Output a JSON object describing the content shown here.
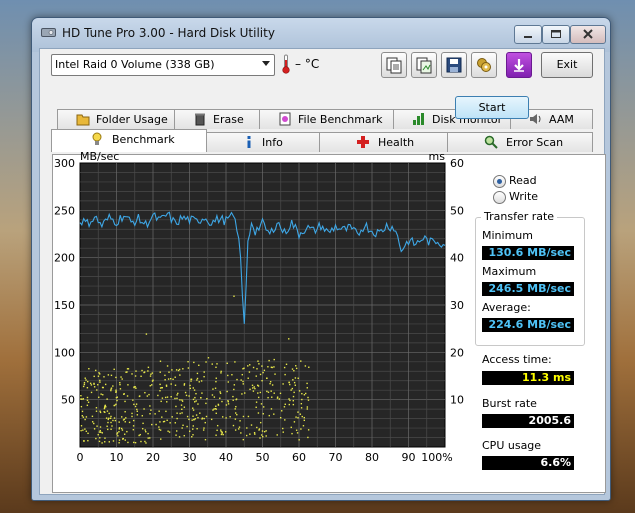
{
  "window": {
    "title": "HD Tune Pro 3.00 - Hard Disk Utility"
  },
  "toolbar": {
    "drive": "Intel  Raid 0 Volume (338 GB)",
    "temperature": "– °C",
    "exit_label": "Exit"
  },
  "tabs_top": [
    {
      "label": "Folder Usage",
      "icon": "folder-icon"
    },
    {
      "label": "Erase",
      "icon": "trash-icon"
    },
    {
      "label": "File Benchmark",
      "icon": "file-benchmark-icon"
    },
    {
      "label": "Disk monitor",
      "icon": "disk-monitor-icon"
    },
    {
      "label": "AAM",
      "icon": "speaker-icon"
    }
  ],
  "tabs_bottom": [
    {
      "label": "Benchmark",
      "icon": "bulb-icon",
      "active": true
    },
    {
      "label": "Info",
      "icon": "info-icon"
    },
    {
      "label": "Health",
      "icon": "health-cross-icon"
    },
    {
      "label": "Error Scan",
      "icon": "magnifier-icon"
    }
  ],
  "controls": {
    "start_label": "Start",
    "read_label": "Read",
    "write_label": "Write",
    "selected": "Read"
  },
  "stats": {
    "transfer_rate_title": "Transfer rate",
    "minimum_label": "Minimum",
    "minimum_value": "130.6 MB/sec",
    "maximum_label": "Maximum",
    "maximum_value": "246.5 MB/sec",
    "average_label": "Average:",
    "average_value": "224.6 MB/sec",
    "access_label": "Access time:",
    "access_value": "11.3 ms",
    "burst_label": "Burst rate",
    "burst_value": "2005.6 MB/sec",
    "cpu_label": "CPU usage",
    "cpu_value": "6.6%"
  },
  "colors": {
    "plot_bg": "#262626",
    "transfer_line": "#3ea7e6",
    "access_dots": "#e8e84a",
    "stat_value_cyan": "#4fc3f7",
    "stat_value_yellow": "#ffff00"
  },
  "chart_data": {
    "type": "line",
    "y_left_unit": "MB/sec",
    "y_right_unit": "ms",
    "y_left_ticks": [
      "300",
      "250",
      "200",
      "150",
      "100",
      "50"
    ],
    "y_right_ticks": [
      "60",
      "50",
      "40",
      "30",
      "20",
      "10"
    ],
    "x_ticks": [
      "0",
      "10",
      "20",
      "30",
      "40",
      "50",
      "60",
      "70",
      "80",
      "90",
      "100%"
    ],
    "y_left_range": [
      0,
      300
    ],
    "y_right_range": [
      0,
      60
    ],
    "x_range": [
      0,
      100
    ],
    "grid": true,
    "series": [
      {
        "kind": "transfer_rate_line",
        "x": [
          0,
          2,
          4,
          6,
          8,
          10,
          12,
          14,
          16,
          18,
          20,
          22,
          24,
          26,
          28,
          30,
          32,
          34,
          36,
          38,
          40,
          42,
          43,
          44,
          44.5,
          45,
          45.5,
          46,
          47,
          48,
          50,
          52,
          54,
          56,
          58,
          60,
          62,
          64,
          66,
          68,
          70,
          72,
          74,
          76,
          78,
          80,
          82,
          84,
          86,
          87,
          88,
          90,
          92,
          94,
          96,
          98,
          100
        ],
        "y": [
          240,
          236,
          243,
          234,
          242,
          238,
          245,
          237,
          241,
          235,
          244,
          239,
          246,
          236,
          242,
          240,
          238,
          243,
          237,
          241,
          239,
          244,
          232,
          200,
          160,
          130,
          170,
          215,
          238,
          228,
          236,
          224,
          238,
          226,
          237,
          225,
          232,
          228,
          234,
          226,
          233,
          229,
          231,
          224,
          235,
          228,
          226,
          234,
          232,
          222,
          208,
          218,
          214,
          221,
          216,
          218,
          213
        ]
      },
      {
        "kind": "access_time_scatter",
        "axis": "right",
        "note_range_x": [
          0,
          63
        ],
        "typical_ms_range": [
          1,
          17
        ],
        "outliers_ms": [
          24,
          19,
          32,
          23
        ]
      }
    ]
  }
}
